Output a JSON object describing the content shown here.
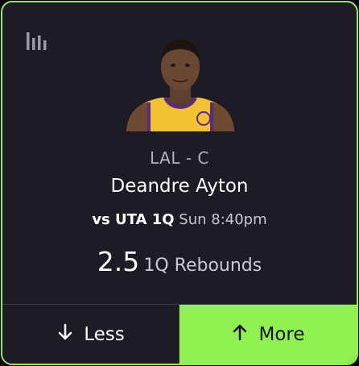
{
  "card": {
    "icons": {
      "stats": "bar-chart-icon",
      "less_arrow": "arrow-down-icon",
      "more_arrow": "arrow-up-icon"
    },
    "colors": {
      "accent": "#8ff04f",
      "card_bg": "#1c1b26",
      "jersey": "#f3c233"
    }
  },
  "player": {
    "team_position": "LAL - C",
    "name": "Deandre Ayton"
  },
  "matchup": {
    "opponent": "vs UTA 1Q",
    "time": "Sun 8:40pm"
  },
  "projection": {
    "value": "2.5",
    "stat": "1Q Rebounds"
  },
  "buttons": {
    "less_label": "Less",
    "more_label": "More"
  }
}
